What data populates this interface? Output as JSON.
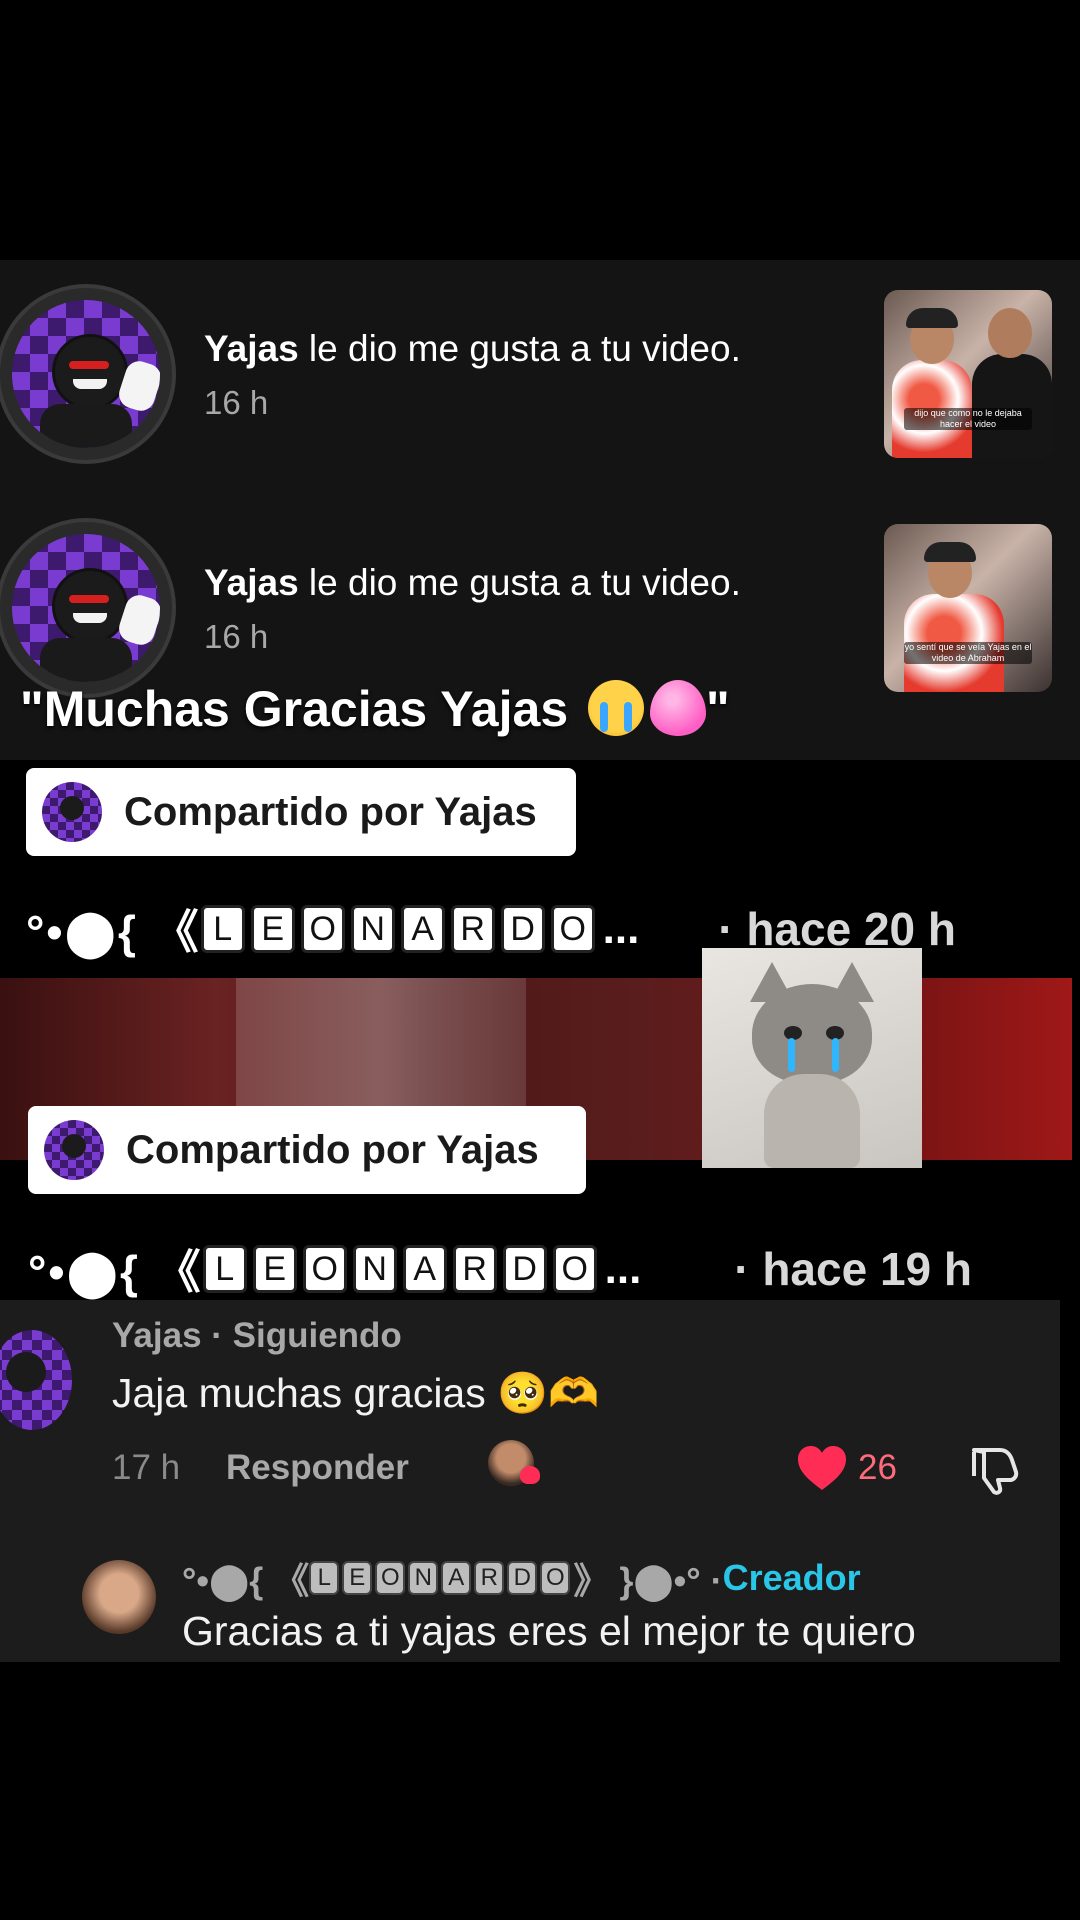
{
  "notifications": [
    {
      "user": "Yajas",
      "action": " le dio me gusta a tu video.",
      "time": "16 h",
      "thumb_caption": "dijo que como no le dejaba hacer el video"
    },
    {
      "user": "Yajas",
      "action": " le dio me gusta a tu video.",
      "time": "16 h",
      "thumb_caption": "yo sentí que se veía Yajas en el video de Abraham"
    }
  ],
  "caption": "\"Muchas Gracias Yajas ",
  "caption_end": "\"",
  "share_blocks": [
    {
      "label": "Compartido por Yajas",
      "prefix": "°•⬤{ 《",
      "letters": [
        "L",
        "E",
        "O",
        "N",
        "A",
        "R",
        "D",
        "O"
      ],
      "ellipsis": "...",
      "time": "· hace 20 h"
    },
    {
      "label": "Compartido por Yajas",
      "prefix": "°•⬤{ 《",
      "letters": [
        "L",
        "E",
        "O",
        "N",
        "A",
        "R",
        "D",
        "O"
      ],
      "ellipsis": "...",
      "time": "· hace 19 h"
    }
  ],
  "comment": {
    "author": "Yajas · Siguiendo",
    "text": "Jaja muchas gracias 🥺🫶",
    "time": "17 h",
    "reply_label": "Responder",
    "like_count": "26"
  },
  "reply": {
    "prefix": "°•⬤{ 《",
    "letters": [
      "L",
      "E",
      "O",
      "N",
      "A",
      "R",
      "D",
      "O"
    ],
    "suffix": "》 }⬤•° · ",
    "badge": "Creador",
    "text": "Gracias a ti yajas eres el mejor te quiero"
  },
  "colors": {
    "accent_creator": "#29c6e8",
    "like": "#ff2d55",
    "panel": "#141414"
  }
}
